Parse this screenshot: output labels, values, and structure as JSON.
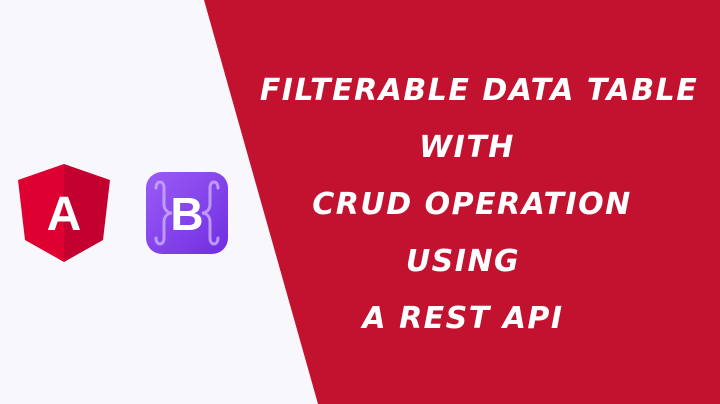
{
  "headline": {
    "lines": [
      "FILTERABLE DATA TABLE",
      "WITH",
      "CRUD OPERATION",
      "USING",
      "A REST API"
    ]
  },
  "logos": {
    "angular": {
      "letter": "A",
      "icon": "angular-logo",
      "colors": [
        "#dd0031",
        "#c3002f"
      ]
    },
    "bootstrap": {
      "letter": "B",
      "icon": "bootstrap-logo",
      "colors": [
        "#8b4cf5",
        "#6f2ee0"
      ]
    }
  },
  "colors": {
    "background": "#f8f7fb",
    "accent": "#c2122f",
    "text": "#ffffff"
  }
}
